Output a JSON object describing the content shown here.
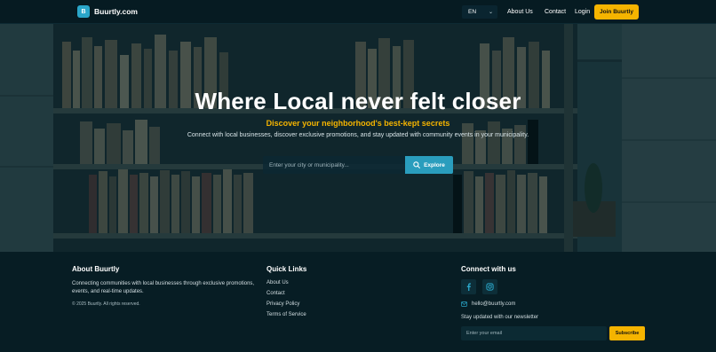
{
  "header": {
    "logo_letter": "B",
    "brand": "Buurtly.com",
    "language": "EN",
    "nav": {
      "about": "About Us",
      "contact": "Contact",
      "login": "Login"
    },
    "join_label": "Join Buurtly"
  },
  "hero": {
    "title": "Where Local never felt closer",
    "subtitle": "Discover your neighborhood's best-kept secrets",
    "text": "Connect with local businesses, discover exclusive promotions, and stay updated with community events in your municipality.",
    "search_placeholder": "Enter your city or municipality...",
    "explore_label": "Explore"
  },
  "footer": {
    "about": {
      "heading": "About Buurtly",
      "description": "Connecting communities with local businesses through exclusive promotions, events, and real-time updates.",
      "copyright": "© 2025 Buurtly. All rights reserved."
    },
    "quick_links": {
      "heading": "Quick Links",
      "items": [
        "About Us",
        "Contact",
        "Privacy Policy",
        "Terms of Service"
      ]
    },
    "connect": {
      "heading": "Connect with us",
      "social_icons": [
        "facebook-icon",
        "instagram-icon"
      ],
      "email": "hello@buurtly.com",
      "newsletter_label": "Stay updated with our newsletter",
      "newsletter_placeholder": "Enter your email",
      "subscribe_label": "Subscribe"
    }
  },
  "colors": {
    "background": "#071d24",
    "accent_yellow": "#f5b400",
    "accent_blue": "#2a9dbd"
  }
}
